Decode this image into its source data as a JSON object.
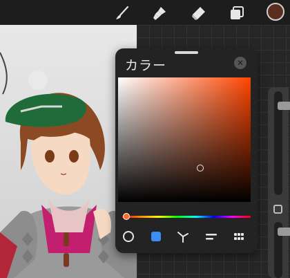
{
  "toolbar": {
    "tools": [
      {
        "name": "brush",
        "icon": "brush-icon"
      },
      {
        "name": "smudge",
        "icon": "smudge-icon"
      },
      {
        "name": "eraser",
        "icon": "eraser-icon"
      },
      {
        "name": "layers",
        "icon": "layers-icon"
      }
    ],
    "current_color": "#5a2e1e"
  },
  "color_panel": {
    "title": "カラー",
    "close_icon": "close-icon",
    "hue_color": "#ff4500",
    "selected_saturation": 0.62,
    "selected_brightness": 0.27,
    "hue_position": 0.03,
    "modes": [
      {
        "name": "disc",
        "icon": "disc-mode-icon"
      },
      {
        "name": "classic",
        "icon": "classic-mode-icon",
        "active": true
      },
      {
        "name": "harmony",
        "icon": "harmony-mode-icon"
      },
      {
        "name": "value",
        "icon": "value-mode-icon"
      },
      {
        "name": "palettes",
        "icon": "palettes-mode-icon"
      }
    ]
  },
  "sidebar": {
    "brush_size": 0.1,
    "opacity": 0.1
  },
  "colors": {
    "panel_bg": "#232323",
    "accent_blue": "#3a8ef6"
  }
}
